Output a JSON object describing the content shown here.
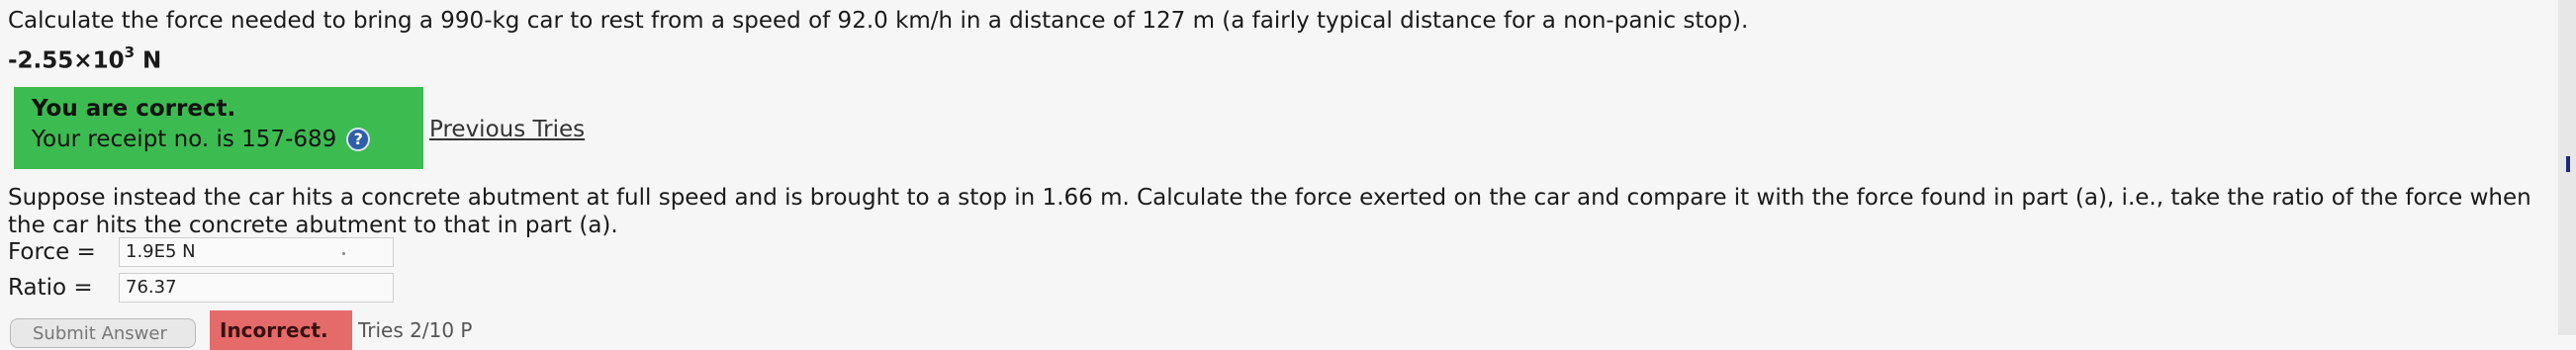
{
  "question_a": {
    "text": "Calculate the force needed to bring a 990-kg car to rest from a speed of 92.0 km/h in a distance of 127 m (a fairly typical distance for a non-panic stop).",
    "answer_prefix": "-2.55×10",
    "answer_exp": "3",
    "answer_unit": " N"
  },
  "feedback": {
    "correct_label": "You are correct.",
    "receipt": "Your receipt no. is 157-689",
    "help_icon": "question-circle-icon",
    "previous_tries": "Previous Tries"
  },
  "question_b": {
    "text": "Suppose instead the car hits a concrete abutment at full speed and is brought to a stop in 1.66 m. Calculate the force exerted on the car and compare it with the force found in part (a), i.e., take the ratio of the force when the car hits the concrete abutment to that in part (a).",
    "force_label": "Force =",
    "force_value": "1.9E5 N",
    "ratio_label": "Ratio =",
    "ratio_value": "76.37"
  },
  "actions": {
    "submit_label": "Submit Answer",
    "incorrect_label": "Incorrect.",
    "tries_text": "Tries 2/10 P"
  },
  "colors": {
    "correct_bg": "#3cbc50",
    "incorrect_bg": "#e56a6a"
  }
}
